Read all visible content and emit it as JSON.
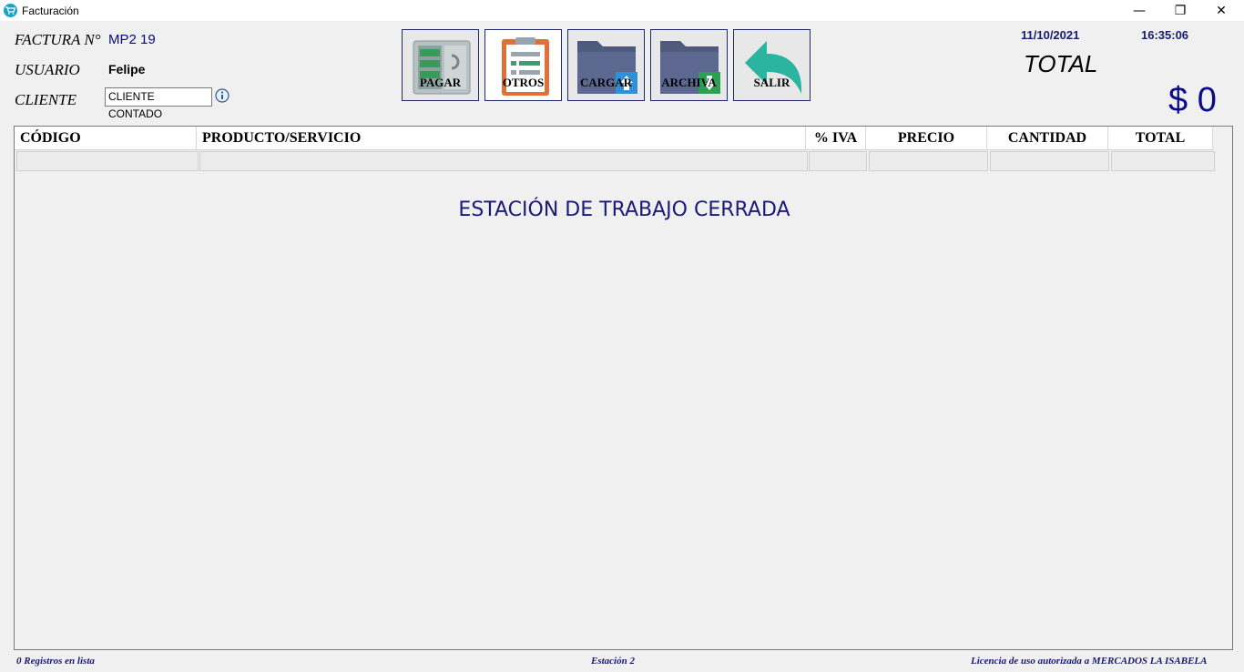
{
  "window": {
    "title": "Facturación",
    "minimize": "—",
    "restore": "❐",
    "close": "✕"
  },
  "header": {
    "factura_label": "FACTURA N°",
    "factura_value": "MP2 19",
    "usuario_label": "USUARIO",
    "usuario_value": "Felipe",
    "cliente_label": "CLIENTE",
    "cliente_value": "CLIENTE CONTADO",
    "date": "11/10/2021",
    "time": "16:35:06",
    "total_label": "TOTAL",
    "total_value": "$ 0"
  },
  "toolbar": {
    "pagar": "PAGAR",
    "otros": "OTROS",
    "cargar": "CARGAR",
    "archiva": "ARCHIVA",
    "salir": "SALIR"
  },
  "grid": {
    "columns": [
      "CÓDIGO",
      "PRODUCTO/SERVICIO",
      "% IVA",
      "PRECIO",
      "CANTIDAD",
      "TOTAL"
    ],
    "message": "ESTACIÓN DE TRABAJO CERRADA"
  },
  "status": {
    "records": "0 Registros en lista",
    "station": "Estación 2",
    "license": "Licencia de uso autorizada a MERCADOS LA ISABELA"
  },
  "colors": {
    "accent_blue": "#0a0a8a",
    "border_navy": "#1e2a6e",
    "otros_orange": "#e0703a",
    "folder_slate": "#4f5b7d",
    "salir_teal": "#2bb5a0"
  }
}
